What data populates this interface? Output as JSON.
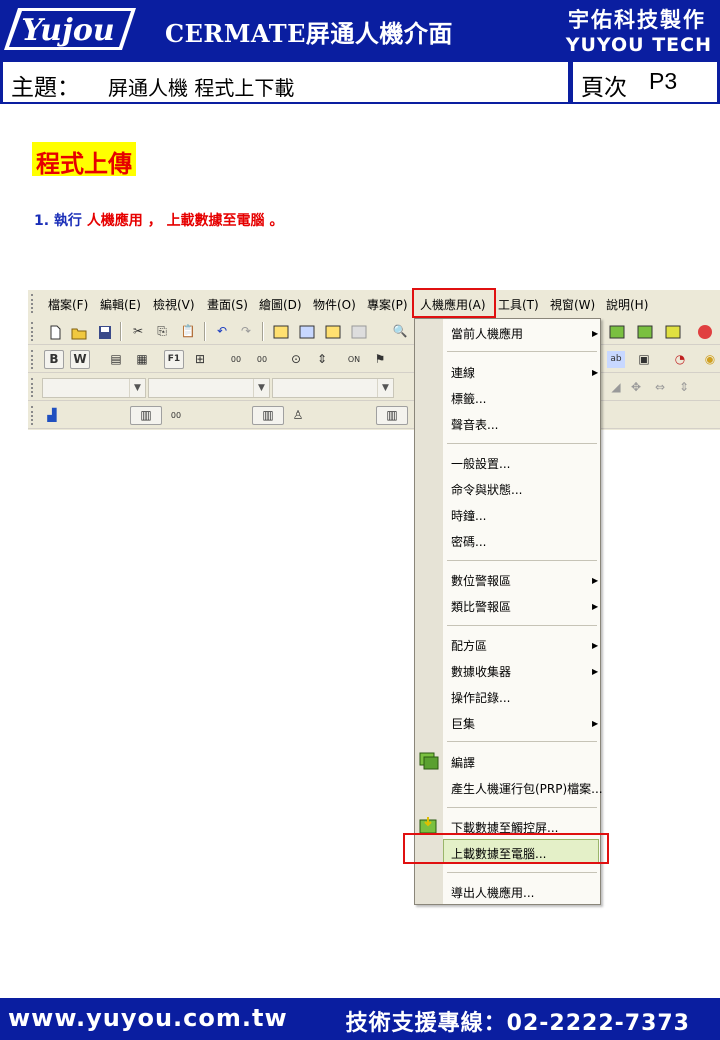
{
  "header": {
    "logo_text": "Yujou",
    "title": "CERMATE屏通人機介面",
    "company_cn": "宇佑科技製作",
    "company_en": "YUYOU TECH"
  },
  "subject": {
    "label": "主題：",
    "text": "屏通人機 程式上下載",
    "page_label": "頁次",
    "page_num": "P3"
  },
  "section": {
    "title": "程式上傳",
    "step_num": "1.",
    "step_prefix": "執行",
    "step_highlight_1": "人機應用",
    "step_sep": "，",
    "step_highlight_2": "上載數據至電腦",
    "step_end": "。"
  },
  "menubar": {
    "items": [
      "檔案(F)",
      "編輯(E)",
      "檢視(V)",
      "畫面(S)",
      "繪圖(D)",
      "物件(O)",
      "專案(P)",
      "人機應用(A)",
      "工具(T)",
      "視窗(W)",
      "說明(H)"
    ]
  },
  "dropdown": {
    "items": [
      "當前人機應用",
      "連線",
      "標籤...",
      "聲音表...",
      "一般設置...",
      "命令與狀態...",
      "時鐘...",
      "密碼...",
      "數位警報區",
      "類比警報區",
      "配方區",
      "數據收集器",
      "操作記錄...",
      "巨集",
      "編譯",
      "產生人機運行包(PRP)檔案...",
      "下載數據至觸控屏...",
      "上載數據至電腦...",
      "導出人機應用..."
    ]
  },
  "toolbar": {
    "icons": [
      "new-file-icon",
      "open-folder-icon",
      "save-icon",
      "cut-icon",
      "copy-icon",
      "paste-icon",
      "undo-icon",
      "redo-icon"
    ]
  },
  "footer": {
    "url": "www.yuyou.com.tw",
    "hotline": "技術支援專線：02-2222-7373"
  },
  "colors": {
    "brand_blue": "#0a1ea0",
    "highlight_red": "#e01010",
    "title_yellow": "#ffff00"
  }
}
